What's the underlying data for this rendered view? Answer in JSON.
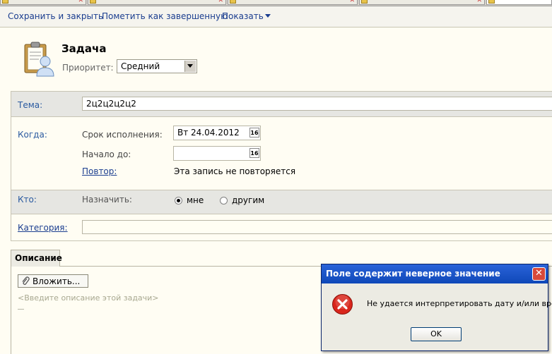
{
  "toolbar": {
    "save_close": "Сохранить и закрыть",
    "mark_done": "Пометить как завершенную",
    "show": "Показать"
  },
  "header": {
    "title": "Задача",
    "priority_label": "Приоритет:",
    "priority_value": "Средний"
  },
  "form": {
    "subject_label": "Тема:",
    "subject_value": "2ц2ц2ц2ц2",
    "when_label": "Когда:",
    "due_label": "Срок исполнения:",
    "due_value": "Вт 24.04.2012",
    "start_label": "Начало до:",
    "start_value": "",
    "calendar_icon_text": "16",
    "repeat_label": "Повтор:",
    "repeat_value": "Эта запись не повторяется",
    "who_label": "Кто:",
    "assign_label": "Назначить:",
    "assign_me": "мне",
    "assign_others": "другим",
    "assign_selected": "me",
    "category_label": "Категория:",
    "category_value": ""
  },
  "description": {
    "tab_label": "Описание",
    "attach_button": "Вложить...",
    "placeholder": "<Введите описание этой задачи>"
  },
  "dialog": {
    "title": "Поле содержит неверное значение",
    "message": "Не удается интерпретировать дату и/или время",
    "ok": "OK",
    "close": "✕"
  },
  "icons": {
    "task": "task-clipboard-person-icon",
    "error": "error-x-icon",
    "attach": "paperclip-icon",
    "calendar": "calendar-icon"
  },
  "colors": {
    "link": "#1a3d8f",
    "label_blue": "#2a5aa0",
    "dialog_title": "#0e48b8",
    "error_red": "#d9261c"
  }
}
